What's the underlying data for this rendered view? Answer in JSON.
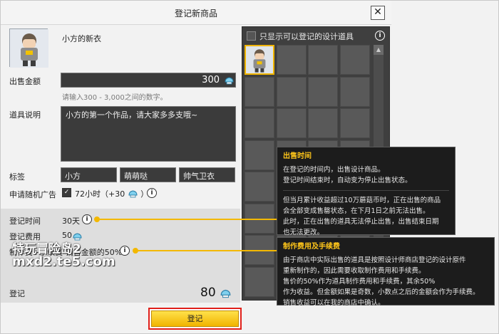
{
  "window": {
    "title": "登记新商品",
    "close_glyph": "✕"
  },
  "item": {
    "name": "小方的新衣"
  },
  "form": {
    "price_label": "出售金额",
    "price_value": "300",
    "price_hint": "请输入300 - 3,000之间的数字。",
    "desc_label": "道具说明",
    "desc_value": "小方的第一个作品，请大家多多支哦~",
    "tags_label": "标签",
    "tags": [
      "小方",
      "萌萌哒",
      "帅气卫衣"
    ],
    "ad_label": "申请随机广告",
    "ad_check_glyph": "✓",
    "ad_text_prefix": "72小时（+30",
    "ad_text_suffix": "）",
    "reg_time_label": "登记时间",
    "reg_time_value": "30天",
    "reg_fee_label": "登记费用",
    "reg_fee_value": "50",
    "commission_label": "制作费+手续费 销售金额的50%",
    "total_label": "登记",
    "total_value": "80",
    "submit_label": "登记"
  },
  "watermark": {
    "line1": "特玩冒险岛2",
    "line2": "mxd2.te5.com"
  },
  "inventory": {
    "filter_label": "只显示可以登记的设计道具",
    "scroll_up_glyph": "▲"
  },
  "tooltips": {
    "time": {
      "title": "出售时间",
      "lines": [
        "在登记的时间内，出售设计商品。",
        "登记时间结束时，自动变为停止出售状态。"
      ],
      "lines2": [
        "但当月累计收益超过10万蘑菇币时，正在出售的商品",
        "会全部变成售罄状态，在下月1日之前无法出售。",
        "此时，正在出售的道具无法停止出售，出售结束日期",
        "也无法更改。"
      ]
    },
    "fee": {
      "title": "制作费用及手续费",
      "lines": [
        "由于商店中实际出售的道具是按照设计师商店登记的设计原件",
        "重新制作的，因此需要收取制作费用和手续费。",
        "售价的50%作为道具制作费用和手续费，其余50%",
        "作为收益。但金额如果是奇数，小数点之后的金额会作为手续费。",
        "销售收益可以在我的商店中确认。"
      ]
    }
  },
  "icons": {
    "mesos": "mesos-icon",
    "info": "info-icon",
    "info_glyph": "i"
  },
  "colors": {
    "accent": "#f3b800",
    "button": "#ffd21a",
    "highlight_border": "#e0201a",
    "tooltip_title": "#ffc61a"
  }
}
